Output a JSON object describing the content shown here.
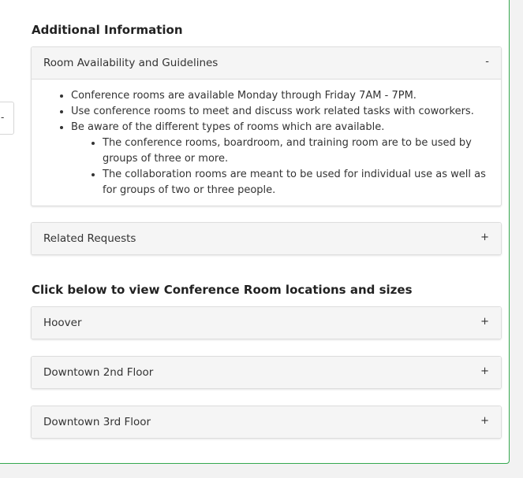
{
  "sections": {
    "additional_info_heading": "Additional Information",
    "locations_heading": "Click below to view Conference Room locations and sizes"
  },
  "left_tab": {
    "glyph": "-"
  },
  "availability_panel": {
    "title": "Room Availability and Guidelines",
    "toggle": "-",
    "bullets": [
      "Conference rooms are available Monday through Friday 7AM - 7PM.",
      "Use conference rooms to meet and discuss work related tasks with coworkers.",
      "Be aware of the different types of rooms which are available."
    ],
    "sub_bullets": [
      "The conference rooms, boardroom, and training room are to be used by groups of three or more.",
      "The collaboration rooms are meant to be used for individual use as well as for groups of two or three people."
    ]
  },
  "related_panel": {
    "title": "Related Requests",
    "toggle": "+"
  },
  "location_panels": [
    {
      "title": "Hoover",
      "toggle": "+"
    },
    {
      "title": "Downtown 2nd Floor",
      "toggle": "+"
    },
    {
      "title": "Downtown 3rd Floor",
      "toggle": "+"
    }
  ],
  "colors": {
    "card_border": "#35a84f",
    "panel_header_bg": "#f5f5f5",
    "page_bg": "#f2f2f2"
  }
}
